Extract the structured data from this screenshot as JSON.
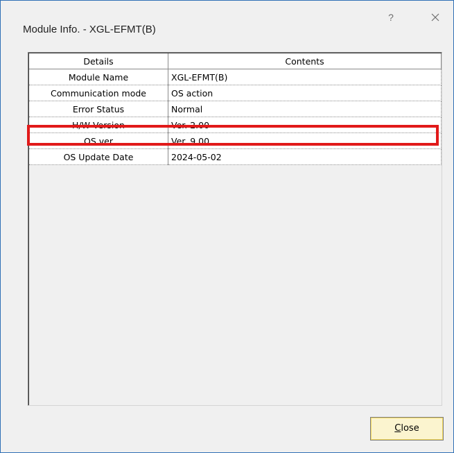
{
  "window": {
    "title": "Module Info. - XGL-EFMT(B)",
    "help_glyph": "?",
    "close_glyph": "close"
  },
  "table": {
    "headers": [
      "Details",
      "Contents"
    ],
    "rows": [
      {
        "detail": "Module Name",
        "content": "XGL-EFMT(B)"
      },
      {
        "detail": "Communication mode",
        "content": "OS action"
      },
      {
        "detail": "Error Status",
        "content": "Normal"
      },
      {
        "detail": "H/W Version",
        "content": "Ver. 2.00"
      },
      {
        "detail": "OS ver",
        "content": "Ver. 9.00"
      },
      {
        "detail": "OS Update Date",
        "content": "2024-05-02"
      }
    ],
    "highlighted_row": "H/W Version",
    "highlight_color": "#e11a1a"
  },
  "footer": {
    "close_mnemonic": "C",
    "close_rest": "lose"
  }
}
